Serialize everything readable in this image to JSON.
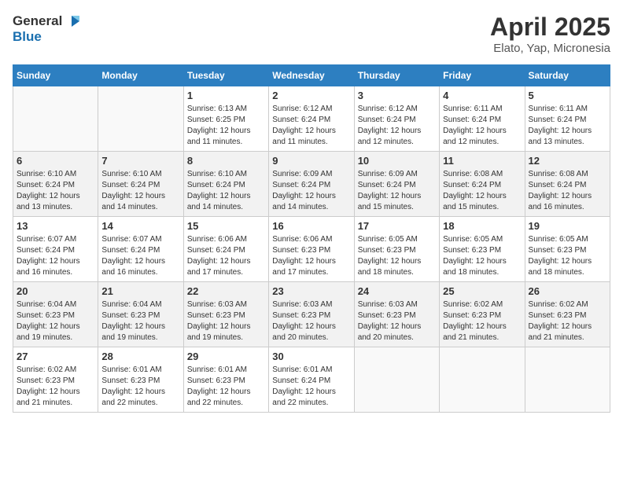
{
  "header": {
    "logo_general": "General",
    "logo_blue": "Blue",
    "month": "April 2025",
    "location": "Elato, Yap, Micronesia"
  },
  "weekdays": [
    "Sunday",
    "Monday",
    "Tuesday",
    "Wednesday",
    "Thursday",
    "Friday",
    "Saturday"
  ],
  "rows": [
    [
      {
        "day": "",
        "info": ""
      },
      {
        "day": "",
        "info": ""
      },
      {
        "day": "1",
        "info": "Sunrise: 6:13 AM\nSunset: 6:25 PM\nDaylight: 12 hours and 11 minutes."
      },
      {
        "day": "2",
        "info": "Sunrise: 6:12 AM\nSunset: 6:24 PM\nDaylight: 12 hours and 11 minutes."
      },
      {
        "day": "3",
        "info": "Sunrise: 6:12 AM\nSunset: 6:24 PM\nDaylight: 12 hours and 12 minutes."
      },
      {
        "day": "4",
        "info": "Sunrise: 6:11 AM\nSunset: 6:24 PM\nDaylight: 12 hours and 12 minutes."
      },
      {
        "day": "5",
        "info": "Sunrise: 6:11 AM\nSunset: 6:24 PM\nDaylight: 12 hours and 13 minutes."
      }
    ],
    [
      {
        "day": "6",
        "info": "Sunrise: 6:10 AM\nSunset: 6:24 PM\nDaylight: 12 hours and 13 minutes."
      },
      {
        "day": "7",
        "info": "Sunrise: 6:10 AM\nSunset: 6:24 PM\nDaylight: 12 hours and 14 minutes."
      },
      {
        "day": "8",
        "info": "Sunrise: 6:10 AM\nSunset: 6:24 PM\nDaylight: 12 hours and 14 minutes."
      },
      {
        "day": "9",
        "info": "Sunrise: 6:09 AM\nSunset: 6:24 PM\nDaylight: 12 hours and 14 minutes."
      },
      {
        "day": "10",
        "info": "Sunrise: 6:09 AM\nSunset: 6:24 PM\nDaylight: 12 hours and 15 minutes."
      },
      {
        "day": "11",
        "info": "Sunrise: 6:08 AM\nSunset: 6:24 PM\nDaylight: 12 hours and 15 minutes."
      },
      {
        "day": "12",
        "info": "Sunrise: 6:08 AM\nSunset: 6:24 PM\nDaylight: 12 hours and 16 minutes."
      }
    ],
    [
      {
        "day": "13",
        "info": "Sunrise: 6:07 AM\nSunset: 6:24 PM\nDaylight: 12 hours and 16 minutes."
      },
      {
        "day": "14",
        "info": "Sunrise: 6:07 AM\nSunset: 6:24 PM\nDaylight: 12 hours and 16 minutes."
      },
      {
        "day": "15",
        "info": "Sunrise: 6:06 AM\nSunset: 6:24 PM\nDaylight: 12 hours and 17 minutes."
      },
      {
        "day": "16",
        "info": "Sunrise: 6:06 AM\nSunset: 6:23 PM\nDaylight: 12 hours and 17 minutes."
      },
      {
        "day": "17",
        "info": "Sunrise: 6:05 AM\nSunset: 6:23 PM\nDaylight: 12 hours and 18 minutes."
      },
      {
        "day": "18",
        "info": "Sunrise: 6:05 AM\nSunset: 6:23 PM\nDaylight: 12 hours and 18 minutes."
      },
      {
        "day": "19",
        "info": "Sunrise: 6:05 AM\nSunset: 6:23 PM\nDaylight: 12 hours and 18 minutes."
      }
    ],
    [
      {
        "day": "20",
        "info": "Sunrise: 6:04 AM\nSunset: 6:23 PM\nDaylight: 12 hours and 19 minutes."
      },
      {
        "day": "21",
        "info": "Sunrise: 6:04 AM\nSunset: 6:23 PM\nDaylight: 12 hours and 19 minutes."
      },
      {
        "day": "22",
        "info": "Sunrise: 6:03 AM\nSunset: 6:23 PM\nDaylight: 12 hours and 19 minutes."
      },
      {
        "day": "23",
        "info": "Sunrise: 6:03 AM\nSunset: 6:23 PM\nDaylight: 12 hours and 20 minutes."
      },
      {
        "day": "24",
        "info": "Sunrise: 6:03 AM\nSunset: 6:23 PM\nDaylight: 12 hours and 20 minutes."
      },
      {
        "day": "25",
        "info": "Sunrise: 6:02 AM\nSunset: 6:23 PM\nDaylight: 12 hours and 21 minutes."
      },
      {
        "day": "26",
        "info": "Sunrise: 6:02 AM\nSunset: 6:23 PM\nDaylight: 12 hours and 21 minutes."
      }
    ],
    [
      {
        "day": "27",
        "info": "Sunrise: 6:02 AM\nSunset: 6:23 PM\nDaylight: 12 hours and 21 minutes."
      },
      {
        "day": "28",
        "info": "Sunrise: 6:01 AM\nSunset: 6:23 PM\nDaylight: 12 hours and 22 minutes."
      },
      {
        "day": "29",
        "info": "Sunrise: 6:01 AM\nSunset: 6:23 PM\nDaylight: 12 hours and 22 minutes."
      },
      {
        "day": "30",
        "info": "Sunrise: 6:01 AM\nSunset: 6:24 PM\nDaylight: 12 hours and 22 minutes."
      },
      {
        "day": "",
        "info": ""
      },
      {
        "day": "",
        "info": ""
      },
      {
        "day": "",
        "info": ""
      }
    ]
  ]
}
